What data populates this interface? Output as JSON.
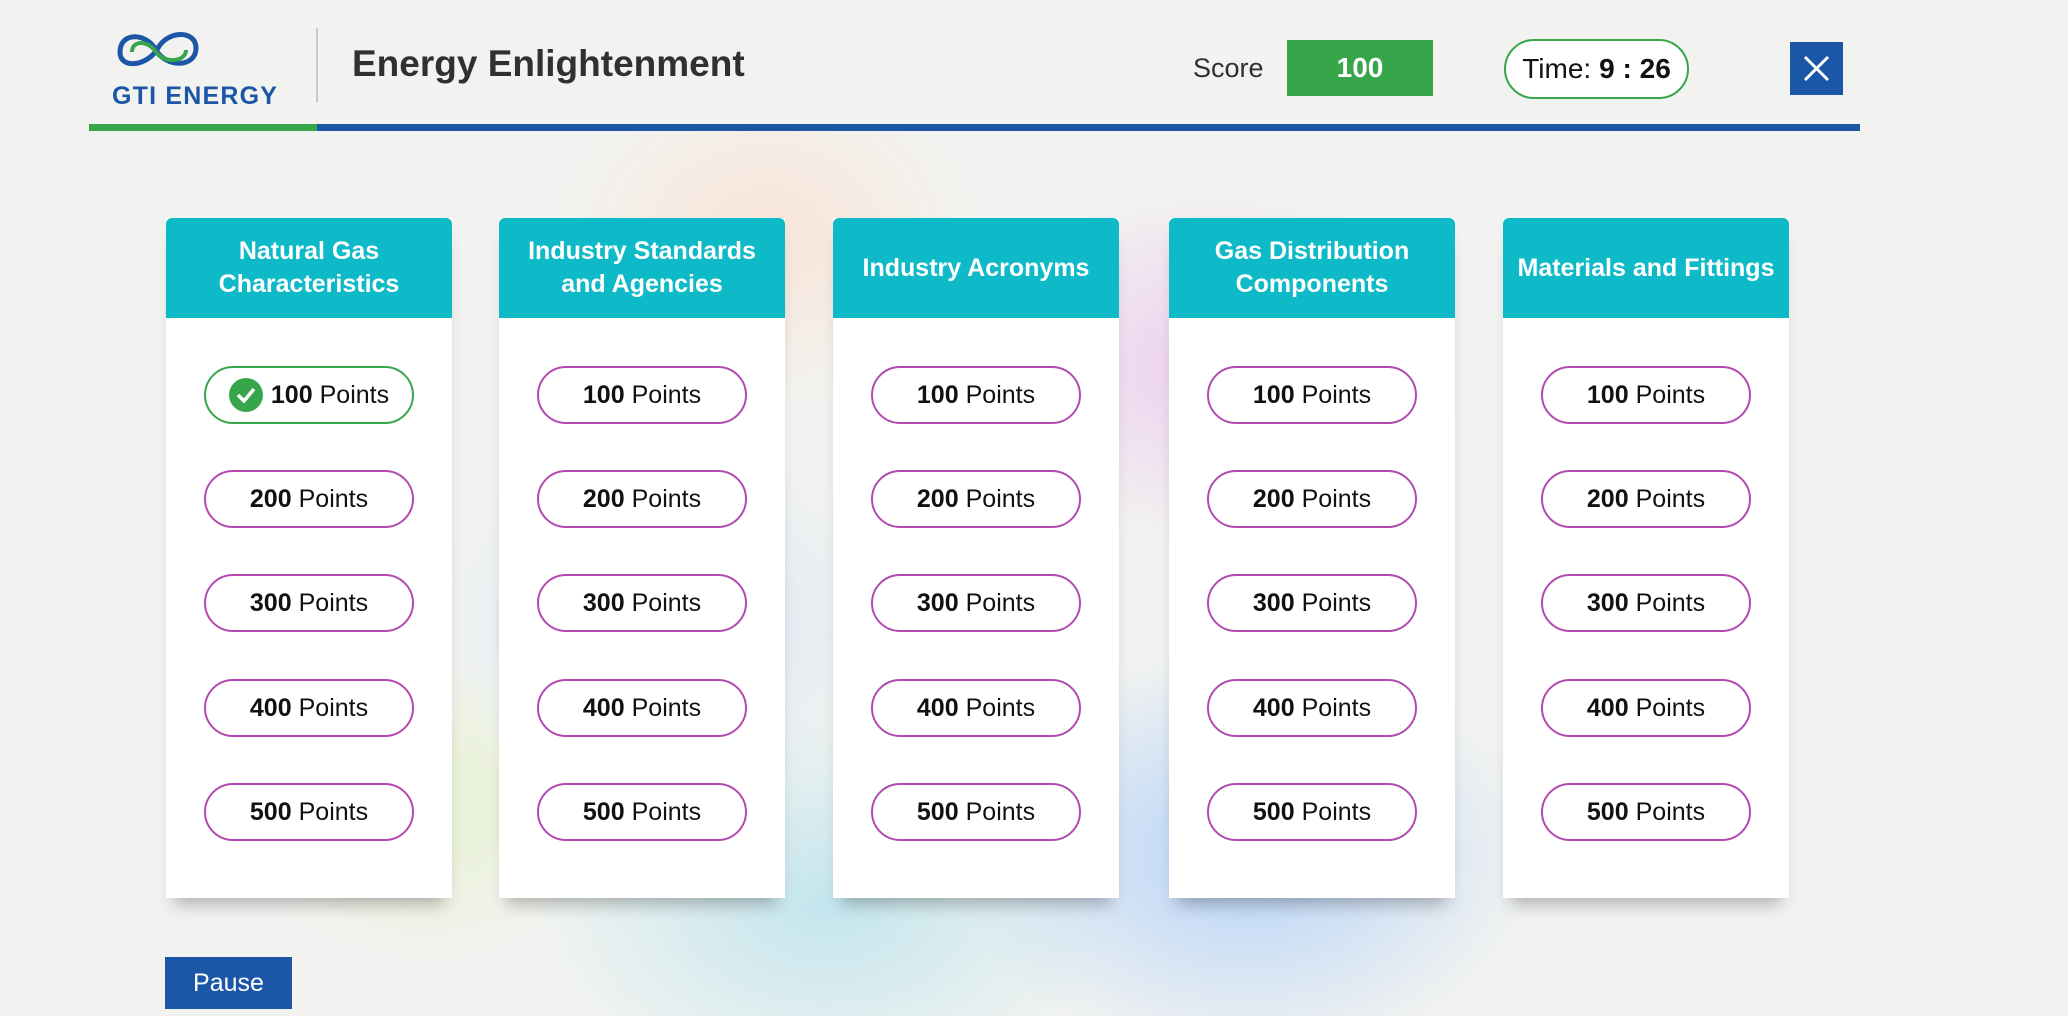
{
  "header": {
    "logo_text": "GTI ENERGY",
    "title": "Energy Enlightenment",
    "score_label": "Score",
    "score_value": "100",
    "timer_label": "Time:",
    "timer_value": "9 : 26",
    "close_icon": "close-icon"
  },
  "colors": {
    "brand_blue": "#1b57a6",
    "brand_green": "#37a64a",
    "category_teal": "#0fbac8",
    "tile_border": "#b24ab0"
  },
  "categories": [
    {
      "title": "Natural Gas Characteristics",
      "tiles": [
        {
          "value": "100",
          "unit": "Points",
          "answered": true
        },
        {
          "value": "200",
          "unit": "Points",
          "answered": false
        },
        {
          "value": "300",
          "unit": "Points",
          "answered": false
        },
        {
          "value": "400",
          "unit": "Points",
          "answered": false
        },
        {
          "value": "500",
          "unit": "Points",
          "answered": false
        }
      ]
    },
    {
      "title": "Industry Standards and Agencies",
      "tiles": [
        {
          "value": "100",
          "unit": "Points",
          "answered": false
        },
        {
          "value": "200",
          "unit": "Points",
          "answered": false
        },
        {
          "value": "300",
          "unit": "Points",
          "answered": false
        },
        {
          "value": "400",
          "unit": "Points",
          "answered": false
        },
        {
          "value": "500",
          "unit": "Points",
          "answered": false
        }
      ]
    },
    {
      "title": "Industry Acronyms",
      "tiles": [
        {
          "value": "100",
          "unit": "Points",
          "answered": false
        },
        {
          "value": "200",
          "unit": "Points",
          "answered": false
        },
        {
          "value": "300",
          "unit": "Points",
          "answered": false
        },
        {
          "value": "400",
          "unit": "Points",
          "answered": false
        },
        {
          "value": "500",
          "unit": "Points",
          "answered": false
        }
      ]
    },
    {
      "title": "Gas Distribution Components",
      "tiles": [
        {
          "value": "100",
          "unit": "Points",
          "answered": false
        },
        {
          "value": "200",
          "unit": "Points",
          "answered": false
        },
        {
          "value": "300",
          "unit": "Points",
          "answered": false
        },
        {
          "value": "400",
          "unit": "Points",
          "answered": false
        },
        {
          "value": "500",
          "unit": "Points",
          "answered": false
        }
      ]
    },
    {
      "title": "Materials and Fittings",
      "tiles": [
        {
          "value": "100",
          "unit": "Points",
          "answered": false
        },
        {
          "value": "200",
          "unit": "Points",
          "answered": false
        },
        {
          "value": "300",
          "unit": "Points",
          "answered": false
        },
        {
          "value": "400",
          "unit": "Points",
          "answered": false
        },
        {
          "value": "500",
          "unit": "Points",
          "answered": false
        }
      ]
    }
  ],
  "footer": {
    "pause_label": "Pause"
  }
}
